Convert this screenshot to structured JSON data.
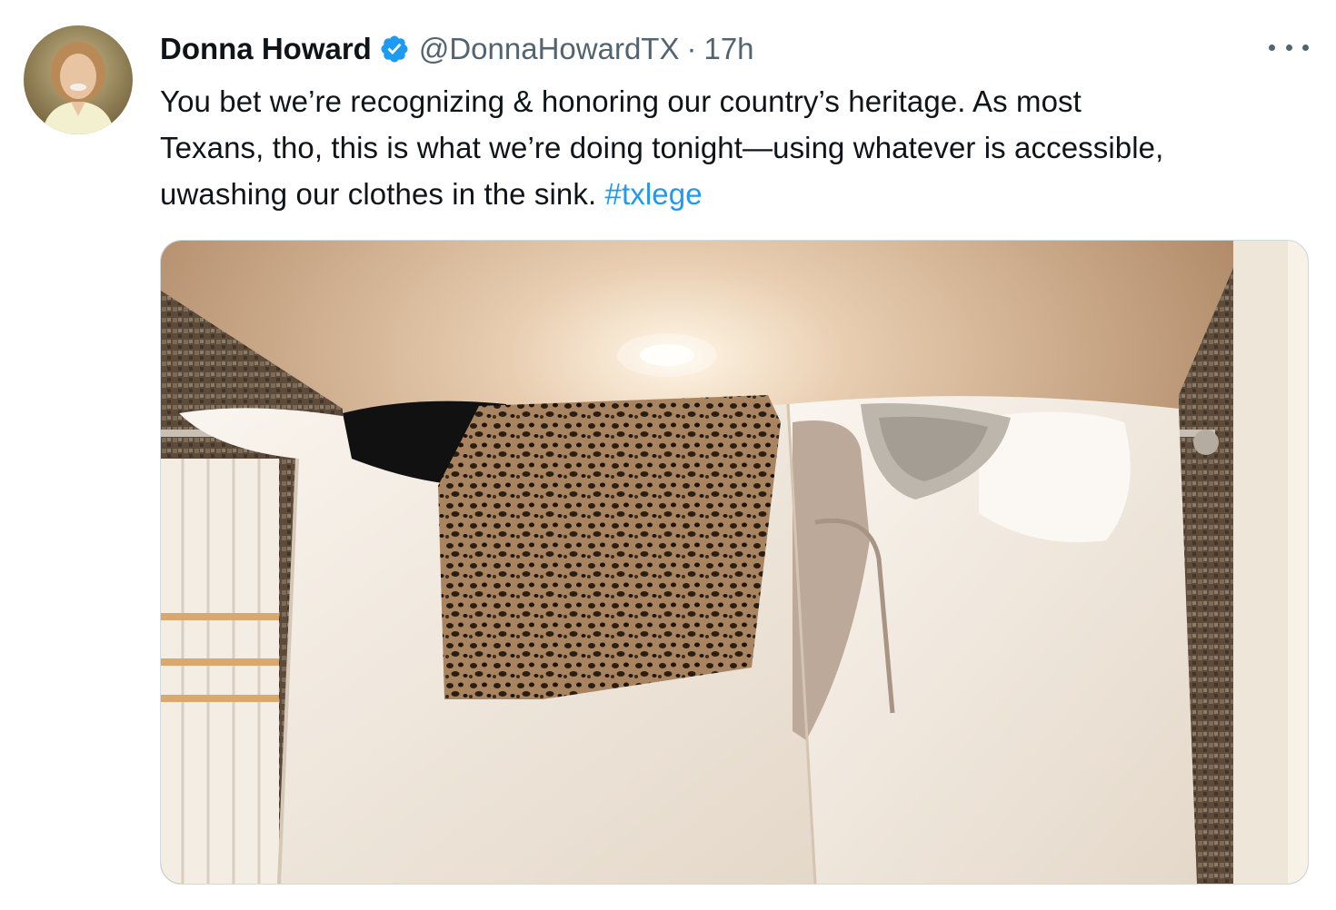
{
  "tweet": {
    "author": {
      "name": "Donna Howard",
      "handle": "@DonnaHowardTX",
      "separator": "·",
      "time": "17h",
      "verified_icon": "verified-badge-icon",
      "avatar_icon": "avatar-photo"
    },
    "text_lines": [
      "You bet we’re recognizing & honoring our country’s heritage. As most",
      "Texans, tho, this is what we’re doing tonight—using whatever is accessible,",
      "uwashing our clothes in the sink."
    ],
    "hashtag": "#txlege",
    "more_icon": "more-options-icon",
    "media": {
      "icon": "photo-laundry-on-shower-rod"
    },
    "colors": {
      "hashtag": "#1d9bf0",
      "verified": "#1d9bf0",
      "secondary_text": "#536471",
      "primary_text": "#0f1419",
      "media_border": "#cfd9de"
    }
  }
}
